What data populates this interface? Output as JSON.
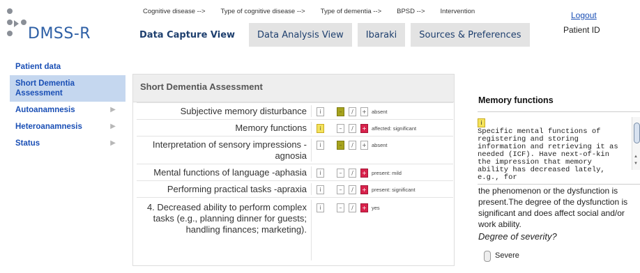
{
  "app": {
    "logo_text": "DMSS-R",
    "logout_label": "Logout",
    "patient_id_label": "Patient ID"
  },
  "breadcrumb": [
    "Cognitive disease -->",
    "Type of cognitive disease -->",
    "Type of dementia -->",
    "BPSD -->",
    "Intervention"
  ],
  "tabs": [
    {
      "label": "Data Capture View",
      "active": true
    },
    {
      "label": "Data Analysis View",
      "active": false
    },
    {
      "label": "Ibaraki",
      "active": false
    },
    {
      "label": "Sources & Preferences",
      "active": false
    }
  ],
  "sidebar": {
    "items": [
      {
        "label": "Patient data",
        "active": false,
        "submenu": false
      },
      {
        "label": "Short Dementia Assessment",
        "active": true,
        "submenu": false
      },
      {
        "label": "Autoanamnesis",
        "active": false,
        "submenu": true
      },
      {
        "label": "Heteroanamnesis",
        "active": false,
        "submenu": true
      },
      {
        "label": "Status",
        "active": false,
        "submenu": true
      }
    ]
  },
  "panel": {
    "title": "Short Dementia Assessment",
    "icons": {
      "info": "i",
      "minus": "–",
      "slash": "/",
      "plus": "+"
    },
    "rows": [
      {
        "label": "Subjective memory disturbance",
        "status": "absent",
        "selected": "minus",
        "info_highlight": false
      },
      {
        "label": "Memory functions",
        "status": "affected: significant",
        "selected": "plus",
        "info_highlight": true
      },
      {
        "label": "Interpretation of sensory impressions -agnosia",
        "status": "absent",
        "selected": "minus",
        "info_highlight": false
      },
      {
        "label": "Mental functions of language -aphasia",
        "status": "present: mild",
        "selected": "plus",
        "info_highlight": false
      },
      {
        "label": "Performing practical tasks -apraxia",
        "status": "present: significant",
        "selected": "plus",
        "info_highlight": false
      },
      {
        "label": "4. Decreased ability to perform complex tasks (e.g., planning dinner for guests; handling finances; marketing).",
        "status": "yes",
        "selected": "plus",
        "info_highlight": false
      }
    ]
  },
  "right_panel": {
    "title": "Memory functions",
    "info_icon": "i",
    "definition": "Specific mental functions of registering and storing information and retrieving it as needed (ICF). Have next-of-kin the impression that memory ability has decreased lately, e.g., for",
    "description": "the phenomenon or the dysfunction is present.The degree of the dysfunction is significant and does affect social and/or work ability.",
    "question": "Degree of severity?",
    "option_label": "Severe"
  },
  "colors": {
    "accent": "#1a4fb5",
    "minus_on": "#a6a31d",
    "plus_on": "#d8224b",
    "info_hl": "#f4e35c",
    "sidebar_active": "#c5d7ef"
  }
}
